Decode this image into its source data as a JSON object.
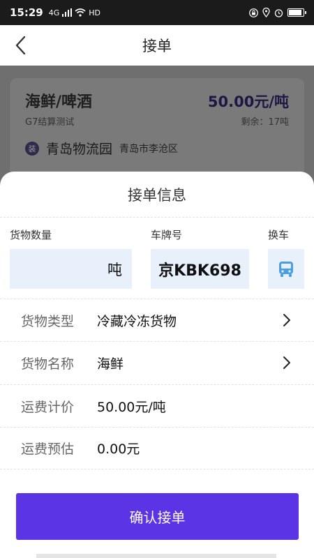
{
  "status_bar": {
    "time": "15:29",
    "network": "4G",
    "hd_label": "HD"
  },
  "nav": {
    "title": "接单"
  },
  "order_card": {
    "goods": "海鲜/啤酒",
    "price": "50.00元/吨",
    "settlement": "G7结算测试",
    "remaining": "剩余：17吨",
    "origin_badge": "装",
    "origin_name": "青岛物流园",
    "origin_district": "青岛市李沧区"
  },
  "sheet": {
    "title": "接单信息",
    "quantity_label": "货物数量",
    "quantity_unit": "吨",
    "plate_label": "车牌号",
    "plate_value": "京KBK698",
    "swap_label": "换车",
    "rows": [
      {
        "label": "货物类型",
        "value": "冷藏冷冻货物"
      },
      {
        "label": "货物名称",
        "value": "海鲜"
      },
      {
        "label": "运费计价",
        "value": "50.00元/吨"
      },
      {
        "label": "运费预估",
        "value": "0.00元"
      }
    ],
    "confirm_label": "确认接单"
  },
  "colors": {
    "accent": "#5b34e5",
    "input_bg": "#e8f1fb",
    "truck_icon": "#4a9fe3"
  },
  "icons": [
    "back-arrow-icon",
    "truck-icon",
    "chevron-right-icon",
    "battery-icon",
    "wifi-icon",
    "signal-icon",
    "alarm-icon",
    "location-icon",
    "lock-icon"
  ]
}
